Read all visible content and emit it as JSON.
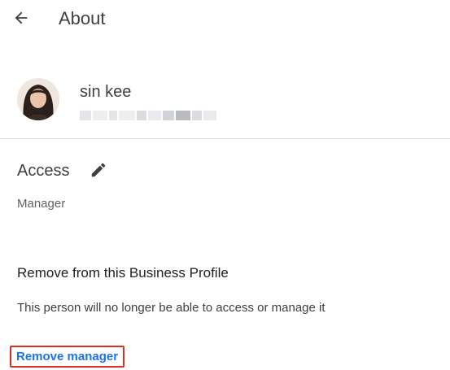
{
  "header": {
    "back_icon": "arrow-back-icon",
    "title": "About"
  },
  "user": {
    "avatar_icon": "user-photo",
    "name": "sin kee",
    "email_redacted": true
  },
  "access": {
    "label": "Access",
    "edit_icon": "pencil-icon",
    "role": "Manager"
  },
  "remove_section": {
    "title": "Remove from this Business Profile",
    "description": "This person will no longer be able to access or manage it",
    "action_label": "Remove manager",
    "highlight_color": "#d93025",
    "link_color": "#1a73e8"
  }
}
